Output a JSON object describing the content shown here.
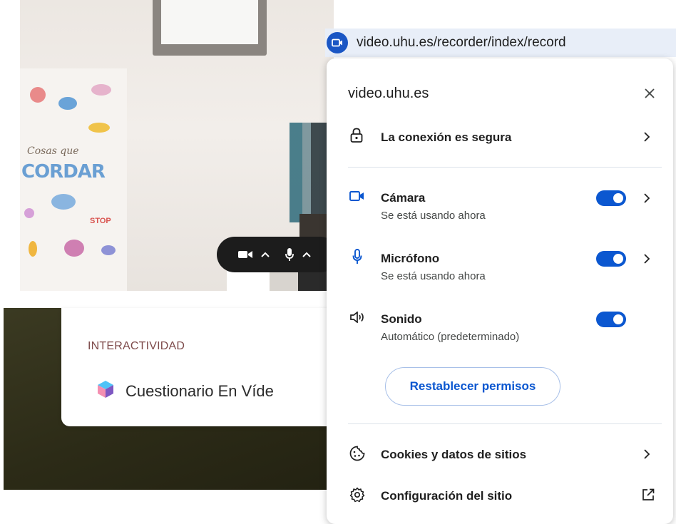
{
  "address_bar": {
    "url": "video.uhu.es/recorder/index/record",
    "site_icon": "video-camera-icon"
  },
  "popup": {
    "title": "video.uhu.es",
    "connection": {
      "label": "La conexión es segura",
      "icon": "lock-icon"
    },
    "permissions": [
      {
        "label": "Cámara",
        "status": "Se está usando ahora",
        "enabled": true,
        "icon": "camera-icon"
      },
      {
        "label": "Micrófono",
        "status": "Se está usando ahora",
        "enabled": true,
        "icon": "microphone-icon"
      },
      {
        "label": "Sonido",
        "status": "Automático (predeterminado)",
        "enabled": true,
        "icon": "speaker-icon"
      }
    ],
    "reset_button": "Restablecer permisos",
    "cookies": {
      "label": "Cookies y datos de sitios",
      "icon": "cookie-icon"
    },
    "site_settings": {
      "label": "Configuración del sitio",
      "icon": "gear-icon"
    }
  },
  "video_preview": {
    "poster_text_1": "Cosas que",
    "poster_text_2": "CORDAR",
    "poster_text_3": "STOP"
  },
  "media_controls": {
    "camera_icon": "camera-icon",
    "mic_icon": "microphone-icon"
  },
  "card": {
    "heading": "INTERACTIVIDAD",
    "item_label": "Cuestionario En Víde",
    "item_icon": "cube-icon"
  },
  "colors": {
    "accent": "#0b57d0",
    "toggle_on": "#0b57d0",
    "heading": "#7d4a4a"
  }
}
